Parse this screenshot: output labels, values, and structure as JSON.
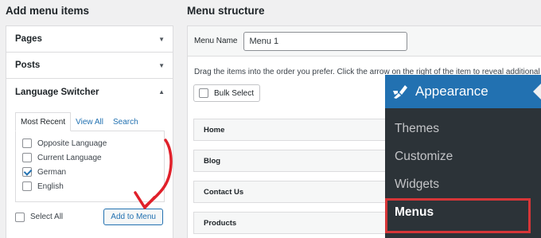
{
  "left": {
    "title": "Add menu items",
    "sections": [
      {
        "label": "Pages"
      },
      {
        "label": "Posts"
      },
      {
        "label": "Language Switcher"
      }
    ],
    "tabs": [
      "Most Recent",
      "View All",
      "Search"
    ],
    "options": [
      {
        "label": "Opposite Language",
        "checked": false
      },
      {
        "label": "Current Language",
        "checked": false
      },
      {
        "label": "German",
        "checked": true
      },
      {
        "label": "English",
        "checked": false
      }
    ],
    "select_all": "Select All",
    "add_button": "Add to Menu"
  },
  "right": {
    "title": "Menu structure",
    "menu_name_label": "Menu Name",
    "menu_name_value": "Menu 1",
    "drag_hint": "Drag the items into the order you prefer. Click the arrow on the right of the item to reveal additional",
    "bulk_select": "Bulk Select",
    "items": [
      "Home",
      "Blog",
      "Contact Us",
      "Products"
    ]
  },
  "flyout": {
    "title": "Appearance",
    "items": [
      "Themes",
      "Customize",
      "Widgets",
      "Menus"
    ],
    "current": "Menus"
  },
  "colors": {
    "accent": "#2271b1",
    "admin_dark": "#2c3338",
    "highlight": "#d63638",
    "annotation_arrow": "#e0202a"
  }
}
